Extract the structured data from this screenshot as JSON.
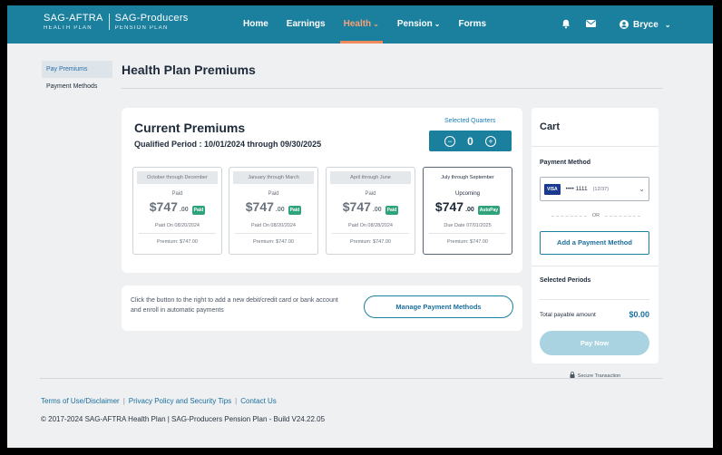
{
  "header": {
    "logo_left_line1": "SAG-AFTRA",
    "logo_left_line2": "HEALTH PLAN",
    "logo_right_line1": "SAG-Producers",
    "logo_right_line2": "PENSION PLAN",
    "nav": [
      {
        "label": "Home"
      },
      {
        "label": "Earnings"
      },
      {
        "label": "Health"
      },
      {
        "label": "Pension"
      },
      {
        "label": "Forms"
      }
    ],
    "user_name": "Bryce"
  },
  "sidebar": {
    "items": [
      {
        "label": "Pay Premiums"
      },
      {
        "label": "Payment Methods"
      }
    ]
  },
  "page": {
    "title": "Health Plan Premiums"
  },
  "premiums": {
    "title": "Current Premiums",
    "qualified_period": "Qualified Period : 10/01/2024 through 09/30/2025",
    "selected_quarters_label": "Selected Quarters",
    "selected_quarters_value": "0",
    "quarters": [
      {
        "period": "October through December",
        "status": "Paid",
        "amount_main": "$747",
        "amount_cents": ".00",
        "badge": "Paid",
        "detail": "Paid On 08/20/2024",
        "premium": "Premium: $747.00"
      },
      {
        "period": "January through March",
        "status": "Paid",
        "amount_main": "$747",
        "amount_cents": ".00",
        "badge": "Paid",
        "detail": "Paid On 08/20/2024",
        "premium": "Premium: $747.00"
      },
      {
        "period": "April through June",
        "status": "Paid",
        "amount_main": "$747",
        "amount_cents": ".00",
        "badge": "Paid",
        "detail": "Paid On 08/28/2024",
        "premium": "Premium: $747.00"
      },
      {
        "period": "July through September",
        "status": "Upcoming",
        "amount_main": "$747",
        "amount_cents": ".00",
        "badge": "AutoPay",
        "detail": "Due Date 07/01/2025",
        "premium": "Premium: $747.00"
      }
    ]
  },
  "manage": {
    "text": "Click the button to the right to add a new debit/credit card or bank account and enroll in automatic payments",
    "button": "Manage Payment Methods"
  },
  "cart": {
    "title": "Cart",
    "payment_method_label": "Payment Method",
    "card_brand": "VISA",
    "card_number": "•••• 1111",
    "card_expiry": "(12/37)",
    "or_label": "OR",
    "add_button": "Add a Payment Method",
    "selected_periods_label": "Selected Periods",
    "total_label": "Total payable amount",
    "total_value": "$0.00",
    "pay_button": "Pay Now",
    "secure_label": "Secure Transaction"
  },
  "footer": {
    "links": [
      {
        "label": "Terms of Use/Disclaimer"
      },
      {
        "label": "Privacy Policy and Security Tips"
      },
      {
        "label": "Contact Us"
      }
    ],
    "copyright": "© 2017-2024 SAG-AFTRA Health Plan | SAG-Producers Pension Plan - Build V24.22.05"
  },
  "colors": {
    "brand": "#1b7f9e",
    "accent": "#f08a5d",
    "paid_badge": "#2fa37a",
    "pay_button_disabled": "#a9d3e0"
  },
  "icons": [
    "bell-icon",
    "envelope-icon",
    "user-avatar-icon",
    "chevron-down-icon",
    "minus-icon",
    "plus-icon",
    "lock-icon"
  ]
}
